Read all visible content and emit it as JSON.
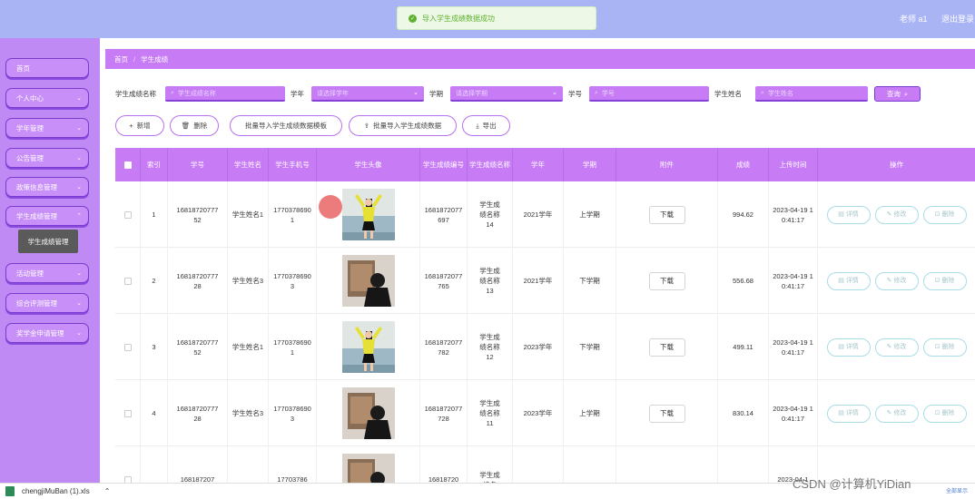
{
  "toast": {
    "message": "导入学生成绩数据成功"
  },
  "header": {
    "user": "老师 a1",
    "logout": "退出登录"
  },
  "sidebar": {
    "items": [
      {
        "label": "首页",
        "has_arrow": false
      },
      {
        "label": "个人中心",
        "has_arrow": true
      },
      {
        "label": "学年管理",
        "has_arrow": true
      },
      {
        "label": "公告管理",
        "has_arrow": true
      },
      {
        "label": "政策信息管理",
        "has_arrow": true
      },
      {
        "label": "学生成绩管理",
        "has_arrow": true
      },
      {
        "label": "活动管理",
        "has_arrow": true
      },
      {
        "label": "综合评测管理",
        "has_arrow": true
      },
      {
        "label": "奖学金申请管理",
        "has_arrow": true
      }
    ],
    "submenu_active": "学生成绩管理"
  },
  "breadcrumb": {
    "home": "首页",
    "separator": "/",
    "current": "学生成绩"
  },
  "filters": {
    "name_label": "学生成绩名称",
    "name_placeholder": "学生成绩名称",
    "year_label": "学年",
    "year_placeholder": "请选择学年",
    "term_label": "学期",
    "term_placeholder": "请选择学期",
    "id_label": "学号",
    "id_placeholder": "学号",
    "student_label": "学生姓名",
    "student_placeholder": "学生姓名",
    "query": "查询"
  },
  "actions": {
    "add": "新增",
    "delete": "删除",
    "template": "批量导入学生成绩数据模板",
    "import": "批量导入学生成绩数据",
    "export": "导出"
  },
  "table": {
    "headers": [
      "索引",
      "学号",
      "学生姓名",
      "学生手机号",
      "学生头像",
      "学生成绩编号",
      "学生成绩名称",
      "学年",
      "学期",
      "附件",
      "成绩",
      "上传时间",
      "操作"
    ],
    "download_label": "下载",
    "op_detail": "详情",
    "op_edit": "修改",
    "op_delete": "删除",
    "rows": [
      {
        "index": "1",
        "sid": "1681872077752",
        "name": "学生姓名1",
        "phone": "17703786901",
        "avatar": "girl",
        "gid": "1681872077697",
        "gname": "学生成绩名称14",
        "year": "2021学年",
        "term": "上学期",
        "score": "994.62",
        "time": "2023-04-19 10:41:17"
      },
      {
        "index": "2",
        "sid": "1681872077728",
        "name": "学生姓名3",
        "phone": "17703786903",
        "avatar": "man",
        "gid": "1681872077765",
        "gname": "学生成绩名称13",
        "year": "2021学年",
        "term": "下学期",
        "score": "556.68",
        "time": "2023-04-19 10:41:17"
      },
      {
        "index": "3",
        "sid": "1681872077752",
        "name": "学生姓名1",
        "phone": "17703786901",
        "avatar": "girl",
        "gid": "1681872077782",
        "gname": "学生成绩名称12",
        "year": "2023学年",
        "term": "下学期",
        "score": "499.11",
        "time": "2023-04-19 10:41:17"
      },
      {
        "index": "4",
        "sid": "1681872077728",
        "name": "学生姓名3",
        "phone": "17703786903",
        "avatar": "man",
        "gid": "1681872077728",
        "gname": "学生成绩名称11",
        "year": "2023学年",
        "term": "上学期",
        "score": "830.14",
        "time": "2023-04-19 10:41:17"
      },
      {
        "index": "",
        "sid": "168187207",
        "name": "",
        "phone": "17703786",
        "avatar": "man",
        "gid": "16818720",
        "gname": "学生成绩名",
        "year": "",
        "term": "",
        "score": "",
        "time": "2023-04-1"
      }
    ]
  },
  "download_bar": {
    "file": "chengjiMuBan (1).xls",
    "show_all": "全部显示"
  },
  "watermark": "CSDN @计算机YiDian"
}
